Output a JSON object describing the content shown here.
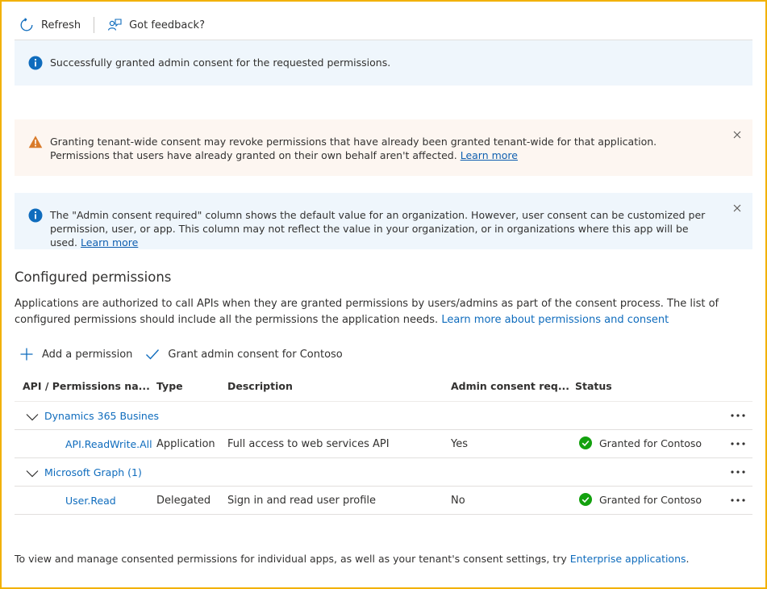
{
  "toolbar": {
    "refresh_label": "Refresh",
    "feedback_label": "Got feedback?"
  },
  "banners": {
    "success": {
      "text": "Successfully granted admin consent for the requested permissions."
    },
    "warning": {
      "text": "Granting tenant-wide consent may revoke permissions that have already been granted tenant-wide for that application. Permissions that users have already granted on their own behalf aren't affected.",
      "link": "Learn more"
    },
    "info": {
      "text": "The \"Admin consent required\" column shows the default value for an organization. However, user consent can be customized per permission, user, or app. This column may not reflect the value in your organization, or in organizations where this app will be used.",
      "link": "Learn more"
    }
  },
  "section": {
    "title": "Configured permissions",
    "description": "Applications are authorized to call APIs when they are granted permissions by users/admins as part of the consent process. The list of configured permissions should include all the permissions the application needs.",
    "description_link": "Learn more about permissions and consent"
  },
  "actions": {
    "add_permission": "Add a permission",
    "grant_consent": "Grant admin consent for Contoso"
  },
  "table": {
    "columns": [
      "API / Permissions na...",
      "Type",
      "Description",
      "Admin consent req...",
      "Status"
    ],
    "groups": [
      {
        "name": "Dynamics 365 Busines",
        "rows": [
          {
            "permission": "API.ReadWrite.All",
            "type": "Application",
            "description": "Full access to web services API",
            "admin_consent": "Yes",
            "status": "Granted for Contoso"
          }
        ]
      },
      {
        "name": "Microsoft Graph (1)",
        "rows": [
          {
            "permission": "User.Read",
            "type": "Delegated",
            "description": "Sign in and read user profile",
            "admin_consent": "No",
            "status": "Granted for Contoso"
          }
        ]
      }
    ]
  },
  "footer": {
    "text": "To view and manage consented permissions for individual apps, as well as your tenant's consent settings, try",
    "link": "Enterprise applications",
    "end": "."
  },
  "colors": {
    "frame_border": "#f2b100",
    "info_bg": "#eff6fc",
    "warn_bg": "#fdf6f1",
    "info_icon": "#0f6cbd",
    "warn_icon": "#d97b2b",
    "success_icon": "#13a10e",
    "link": "#0f6cbd"
  }
}
